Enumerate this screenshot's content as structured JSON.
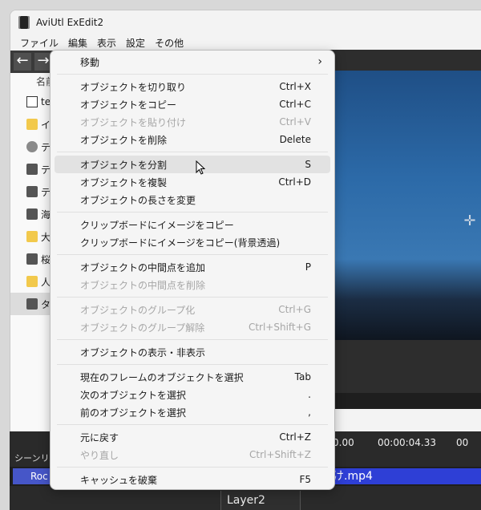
{
  "window": {
    "title": "AviUtl ExEdit2"
  },
  "menubar": [
    "ファイル",
    "編集",
    "表示",
    "設定",
    "その他"
  ],
  "browser": {
    "column_header": "名前",
    "items": [
      {
        "label": "te",
        "icon": "video-file-icon"
      },
      {
        "label": "イ",
        "icon": "folder-icon"
      },
      {
        "label": "テ",
        "icon": "alien-icon"
      },
      {
        "label": "テ",
        "icon": "clapper-icon"
      },
      {
        "label": "テ",
        "icon": "clapper-icon"
      },
      {
        "label": "海",
        "icon": "clapper-icon"
      },
      {
        "label": "大",
        "icon": "folder-icon"
      },
      {
        "label": "桜",
        "icon": "clapper-icon"
      },
      {
        "label": "人",
        "icon": "folder-icon"
      },
      {
        "label": "タ",
        "icon": "clapper-icon"
      }
    ]
  },
  "timeline": {
    "scene_list_label": "シーンリスト",
    "ruler": [
      "0.00",
      "00:00:04.33",
      "00"
    ],
    "clip_left": "Roc",
    "clip_right": "け.mp4",
    "layer_label": "Layer2"
  },
  "context_menu": {
    "items": [
      {
        "label": "移動",
        "shortcut": "",
        "submenu": true,
        "disabled": false
      },
      {
        "sep": true
      },
      {
        "label": "オブジェクトを切り取り",
        "shortcut": "Ctrl+X",
        "disabled": false
      },
      {
        "label": "オブジェクトをコピー",
        "shortcut": "Ctrl+C",
        "disabled": false
      },
      {
        "label": "オブジェクトを貼り付け",
        "shortcut": "Ctrl+V",
        "disabled": true
      },
      {
        "label": "オブジェクトを削除",
        "shortcut": "Delete",
        "disabled": false
      },
      {
        "sep": true
      },
      {
        "label": "オブジェクトを分割",
        "shortcut": "S",
        "disabled": false,
        "hover": true
      },
      {
        "label": "オブジェクトを複製",
        "shortcut": "Ctrl+D",
        "disabled": false
      },
      {
        "label": "オブジェクトの長さを変更",
        "shortcut": "",
        "disabled": false
      },
      {
        "sep": true
      },
      {
        "label": "クリップボードにイメージをコピー",
        "shortcut": "",
        "disabled": false
      },
      {
        "label": "クリップボードにイメージをコピー(背景透過)",
        "shortcut": "",
        "disabled": false
      },
      {
        "sep": true
      },
      {
        "label": "オブジェクトの中間点を追加",
        "shortcut": "P",
        "disabled": false
      },
      {
        "label": "オブジェクトの中間点を削除",
        "shortcut": "",
        "disabled": true
      },
      {
        "sep": true
      },
      {
        "label": "オブジェクトのグループ化",
        "shortcut": "Ctrl+G",
        "disabled": true
      },
      {
        "label": "オブジェクトのグループ解除",
        "shortcut": "Ctrl+Shift+G",
        "disabled": true
      },
      {
        "sep": true
      },
      {
        "label": "オブジェクトの表示・非表示",
        "shortcut": "",
        "disabled": false
      },
      {
        "sep": true
      },
      {
        "label": "現在のフレームのオブジェクトを選択",
        "shortcut": "Tab",
        "disabled": false
      },
      {
        "label": "次のオブジェクトを選択",
        "shortcut": ".",
        "disabled": false
      },
      {
        "label": "前のオブジェクトを選択",
        "shortcut": ",",
        "disabled": false
      },
      {
        "sep": true
      },
      {
        "label": "元に戻す",
        "shortcut": "Ctrl+Z",
        "disabled": false
      },
      {
        "label": "やり直し",
        "shortcut": "Ctrl+Shift+Z",
        "disabled": true
      },
      {
        "sep": true
      },
      {
        "label": "キャッシュを破棄",
        "shortcut": "F5",
        "disabled": false
      }
    ]
  }
}
